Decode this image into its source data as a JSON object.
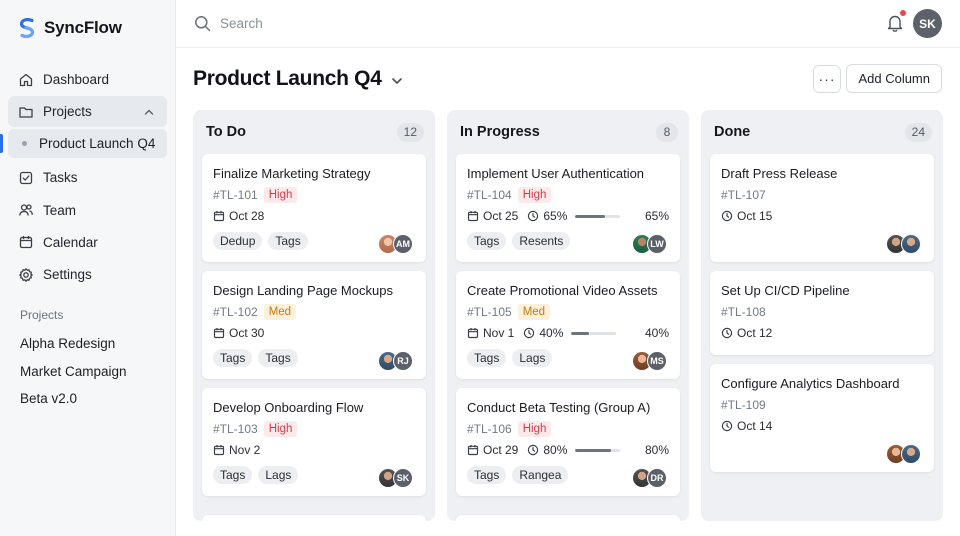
{
  "app": {
    "name": "SyncFlow"
  },
  "sidebar": {
    "nav": [
      {
        "label": "Dashboard",
        "icon": "home-icon"
      },
      {
        "label": "Projects",
        "icon": "folder-icon"
      },
      {
        "label": "Tasks",
        "icon": "checkbox-icon"
      },
      {
        "label": "Team",
        "icon": "users-icon"
      },
      {
        "label": "Calendar",
        "icon": "calendar-icon"
      },
      {
        "label": "Settings",
        "icon": "gear-icon"
      }
    ],
    "active_sub": "Product Launch Q4",
    "section_label": "Projects",
    "projects": [
      "Alpha Redesign",
      "Market Campaign",
      "Beta v2.0"
    ]
  },
  "topbar": {
    "search_placeholder": "Search",
    "user_initials": "SK"
  },
  "page": {
    "title": "Product Launch Q4",
    "more_label": "···",
    "add_column_label": "Add Column"
  },
  "colors": {
    "accent": "#2f6fe4",
    "priority_high": "#d23c48",
    "priority_med": "#c97a12"
  },
  "columns": [
    {
      "title": "To Do",
      "count": "12",
      "cards": [
        {
          "title": "Finalize Marketing Strategy",
          "id": "#TL-101",
          "priority": "High",
          "date": "Oct 28",
          "tags": [
            "Dedup",
            "Tags"
          ],
          "avatars": [
            "photo1",
            "AM"
          ]
        },
        {
          "title": "Design Landing Page Mockups",
          "id": "#TL-102",
          "priority": "Med",
          "date": "Oct 30",
          "tags": [
            "Tags",
            "Tags"
          ],
          "avatars": [
            "photo2",
            "RJ"
          ]
        },
        {
          "title": "Develop Onboarding Flow",
          "id": "#TL-103",
          "priority": "High",
          "date": "Nov 2",
          "tags": [
            "Tags",
            "Lags"
          ],
          "avatars": [
            "photo5",
            "SK"
          ]
        }
      ]
    },
    {
      "title": "In Progress",
      "count": "8",
      "cards": [
        {
          "title": "Implement User Authentication",
          "id": "#TL-104",
          "priority": "High",
          "date": "Oct 25",
          "progress": "65%",
          "progress_value": 0.65,
          "tags": [
            "Tags",
            "Resents"
          ],
          "avatars": [
            "photo3",
            "LW"
          ]
        },
        {
          "title": "Create Promotional Video Assets",
          "id": "#TL-105",
          "priority": "Med",
          "date": "Nov 1",
          "progress": "40%",
          "progress_value": 0.4,
          "tags": [
            "Tags",
            "Lags"
          ],
          "avatars": [
            "photo4",
            "MS"
          ]
        },
        {
          "title": "Conduct Beta Testing (Group A)",
          "id": "#TL-106",
          "priority": "High",
          "date": "Oct 29",
          "progress": "80%",
          "progress_value": 0.8,
          "tags": [
            "Tags",
            "Rangea"
          ],
          "avatars": [
            "photo5",
            "DR"
          ]
        }
      ]
    },
    {
      "title": "Done",
      "count": "24",
      "cards": [
        {
          "title": "Draft Press Release",
          "id": "#TL-107",
          "date": "Oct 15",
          "avatars": [
            "photo5",
            "photo2"
          ]
        },
        {
          "title": "Set Up CI/CD Pipeline",
          "id": "#TL-108",
          "date": "Oct 12",
          "avatars": []
        },
        {
          "title": "Configure Analytics Dashboard",
          "id": "#TL-109",
          "date": "Oct 14",
          "avatars": [
            "photo4",
            "photo2"
          ]
        }
      ]
    }
  ]
}
